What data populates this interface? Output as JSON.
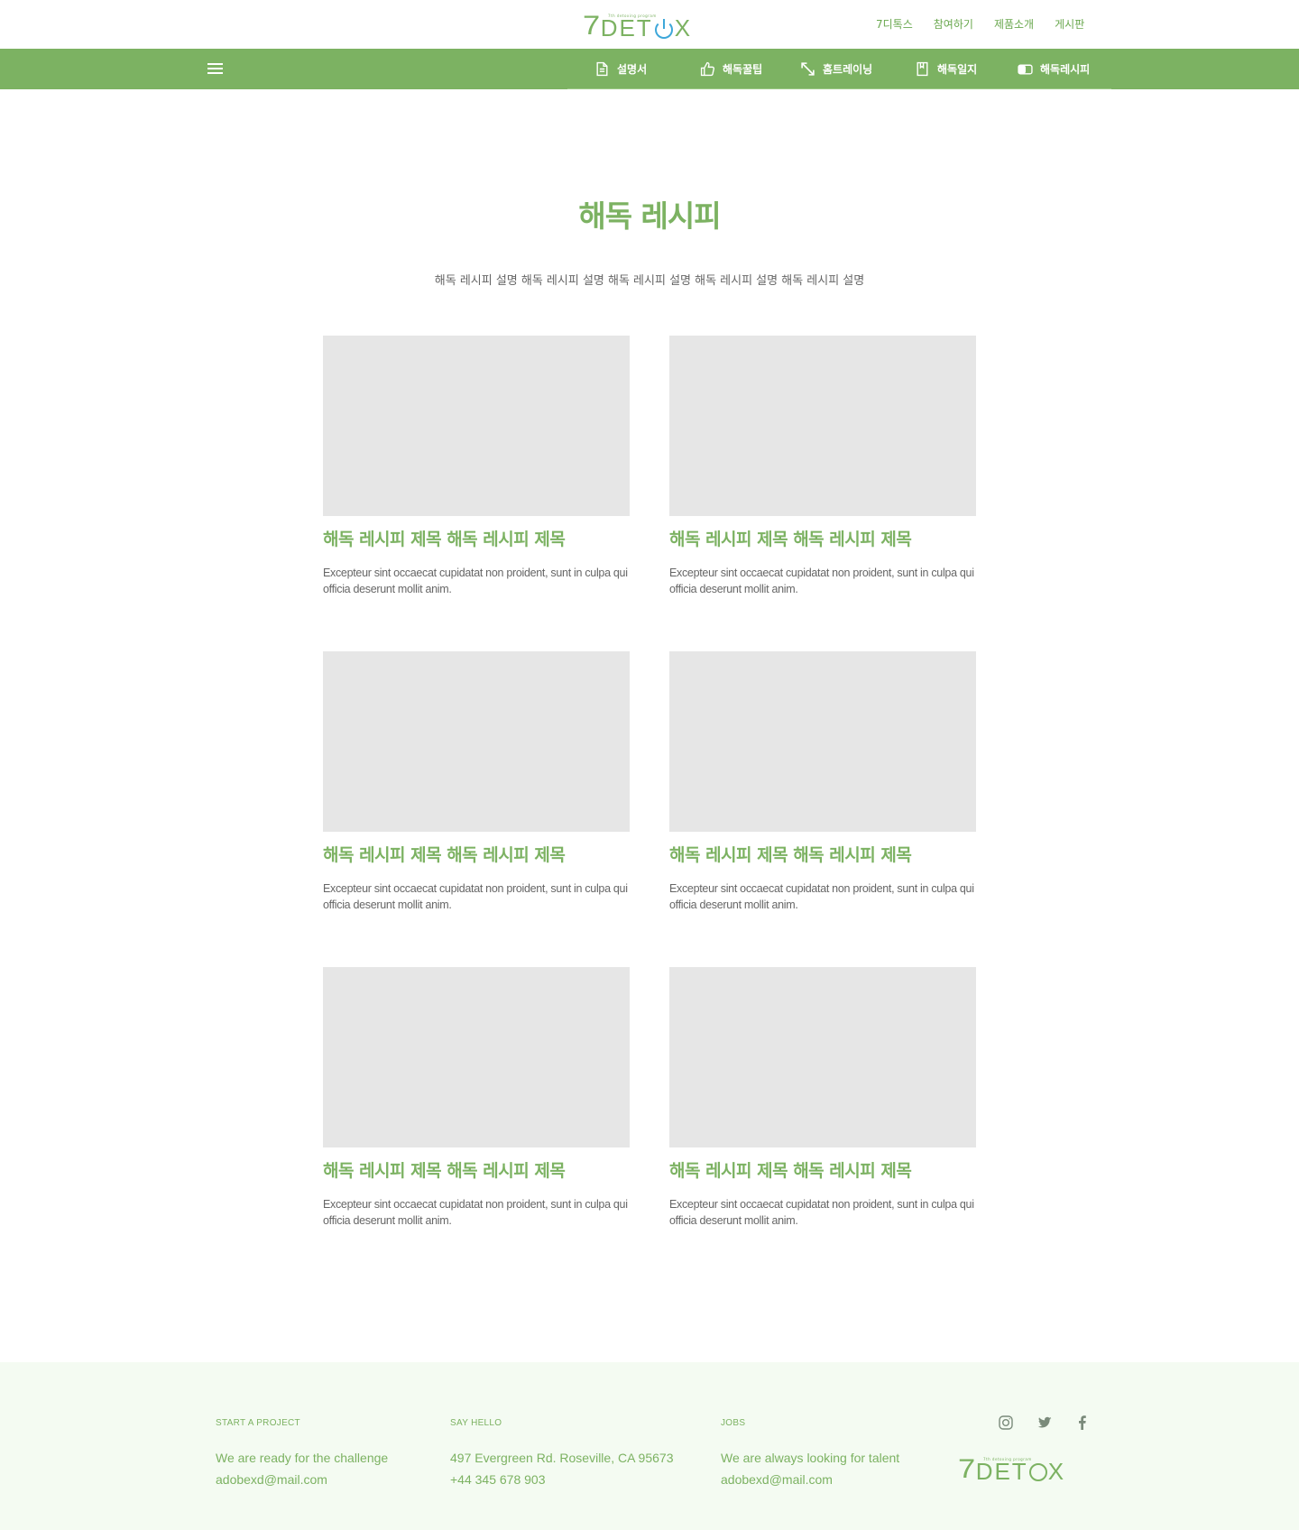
{
  "brand": {
    "logo_tagline": "7th detoxing program",
    "logo_seven": "7",
    "logo_letters_before": "DET",
    "logo_letters_after": "X"
  },
  "top_links": [
    "7디톡스",
    "참여하기",
    "제품소개",
    "게시판"
  ],
  "nav": {
    "items": [
      {
        "label": "설명서",
        "icon": "document-icon"
      },
      {
        "label": "해독꿀팁",
        "icon": "thumbs-up-icon"
      },
      {
        "label": "홈트레이닝",
        "icon": "expand-arrows-icon"
      },
      {
        "label": "해독일지",
        "icon": "bookmark-icon"
      },
      {
        "label": "해독레시피",
        "icon": "toggle-icon"
      }
    ]
  },
  "main": {
    "title": "해독 레시피",
    "description": "해독 레시피 설명 해독 레시피 설명 해독 레시피 설명 해독 레시피 설명 해독 레시피 설명",
    "cards": [
      {
        "title": "해독 레시피 제목 해독 레시피 제목",
        "text": "Excepteur sint occaecat cupidatat non proident, sunt in culpa qui officia deserunt mollit anim."
      },
      {
        "title": "해독 레시피 제목 해독 레시피 제목",
        "text": "Excepteur sint occaecat cupidatat non proident, sunt in culpa qui officia deserunt mollit anim."
      },
      {
        "title": "해독 레시피 제목 해독 레시피 제목",
        "text": "Excepteur sint occaecat cupidatat non proident, sunt in culpa qui officia deserunt mollit anim."
      },
      {
        "title": "해독 레시피 제목 해독 레시피 제목",
        "text": "Excepteur sint occaecat cupidatat non proident, sunt in culpa qui officia deserunt mollit anim."
      },
      {
        "title": "해독 레시피 제목 해독 레시피 제목",
        "text": "Excepteur sint occaecat cupidatat non proident, sunt in culpa qui officia deserunt mollit anim."
      },
      {
        "title": "해독 레시피 제목 해독 레시피 제목",
        "text": "Excepteur sint occaecat cupidatat non proident, sunt in culpa qui officia deserunt mollit anim."
      }
    ]
  },
  "footer": {
    "project": {
      "heading": "START A PROJECT",
      "line1": "We are ready for the challenge",
      "line2": "adobexd@mail.com"
    },
    "hello": {
      "heading": "SAY HELLO",
      "line1": "497 Evergreen Rd. Roseville, CA 95673",
      "line2": "+44 345 678 903"
    },
    "jobs": {
      "heading": "JOBS",
      "line1": "We are always looking for talent",
      "line2": "adobexd@mail.com"
    },
    "social": [
      "instagram-icon",
      "twitter-icon",
      "facebook-icon"
    ]
  },
  "colors": {
    "accent_green": "#7cb262",
    "logo_blue": "#3da7d9",
    "footer_bg": "#f4fbf2",
    "placeholder_gray": "#e6e6e6"
  }
}
